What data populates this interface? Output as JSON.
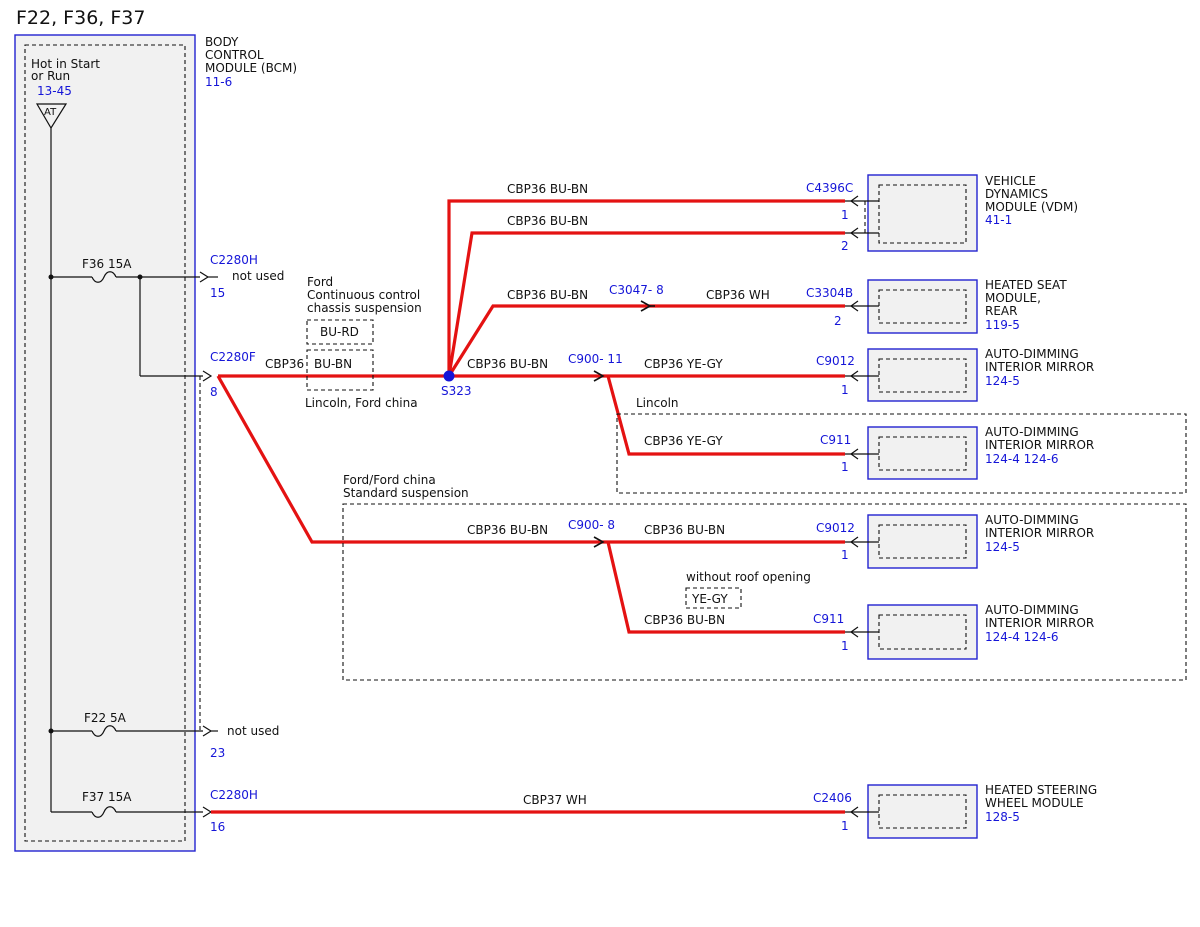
{
  "title": "F22, F36, F37",
  "bcm": {
    "name_lines": [
      "BODY",
      "CONTROL",
      "MODULE (BCM)"
    ],
    "ref": "11-6",
    "hot_lines": [
      "Hot in Start",
      "or Run"
    ],
    "hot_ref": "13-45",
    "at_label": "AT"
  },
  "fuses": {
    "f36": "F36  15A",
    "f22": "F22  5A",
    "f37": "F37  15A"
  },
  "connectors": {
    "c2280h_top": "C2280H",
    "pin_15": "15",
    "not_used_1": "not used",
    "c2280f": "C2280F",
    "pin_8": "8",
    "pin_23": "23",
    "not_used_2": "not used",
    "c2280h_bottom": "C2280H",
    "pin_16": "16",
    "s323": "S323",
    "c4396c": "C4396C",
    "pin_vdm_1": "1",
    "pin_vdm_2": "2",
    "c3047": "C3047- 8",
    "c3304b": "C3304B",
    "pin_hsm_2": "2",
    "c900_11": "C900- 11",
    "c9012_a": "C9012",
    "pin_mirror_a": "1",
    "c911_a": "C911",
    "pin_mirror_b": "1",
    "c900_8": "C900- 8",
    "c9012_b": "C9012",
    "pin_mirror_c": "1",
    "c911_b": "C911",
    "pin_mirror_d": "1",
    "c2406": "C2406",
    "pin_steer": "1"
  },
  "wires": {
    "vdm1": "CBP36  BU-BN",
    "vdm2": "CBP36  BU-BN",
    "hsm_a": "CBP36  BU-BN",
    "hsm_b": "CBP36  WH",
    "main_cbp36": "CBP36",
    "main_bubn": "BU-BN",
    "s323_out": "CBP36  BU-BN",
    "mirror_a": "CBP36  YE-GY",
    "mirror_b": "CBP36  YE-GY",
    "std_in": "CBP36  BU-BN",
    "mirror_c": "CBP36  BU-BN",
    "mirror_d": "CBP36  BU-BN",
    "steer": "CBP37  WH"
  },
  "options": {
    "ford_ccs_lines": [
      "Ford",
      "Continuous control",
      "chassis suspension"
    ],
    "bu_rd": "BU-RD",
    "lincoln_ford_china": "Lincoln, Ford china",
    "lincoln": "Lincoln",
    "std_lines": [
      "Ford/Ford china",
      "Standard suspension"
    ],
    "without_roof": "without roof opening",
    "ye_gy": "YE-GY"
  },
  "modules": {
    "vdm": {
      "lines": [
        "VEHICLE",
        "DYNAMICS",
        "MODULE (VDM)"
      ],
      "ref": "41-1"
    },
    "hsm": {
      "lines": [
        "HEATED SEAT",
        "MODULE,",
        "REAR"
      ],
      "ref": "119-5"
    },
    "mirror_a": {
      "lines": [
        "AUTO-DIMMING",
        "INTERIOR MIRROR"
      ],
      "ref": "124-5"
    },
    "mirror_b": {
      "lines": [
        "AUTO-DIMMING",
        "INTERIOR MIRROR"
      ],
      "ref": "124-4 124-6"
    },
    "mirror_c": {
      "lines": [
        "AUTO-DIMMING",
        "INTERIOR MIRROR"
      ],
      "ref": "124-5"
    },
    "mirror_d": {
      "lines": [
        "AUTO-DIMMING",
        "INTERIOR MIRROR"
      ],
      "ref": "124-4 124-6"
    },
    "steer": {
      "lines": [
        "HEATED STEERING",
        "WHEEL MODULE"
      ],
      "ref": "128-5"
    }
  },
  "colors": {
    "wire": "#e41212",
    "reference_text": "#1515d8",
    "module_outline": "#2323d0",
    "module_fill": "#f1f1f1"
  }
}
